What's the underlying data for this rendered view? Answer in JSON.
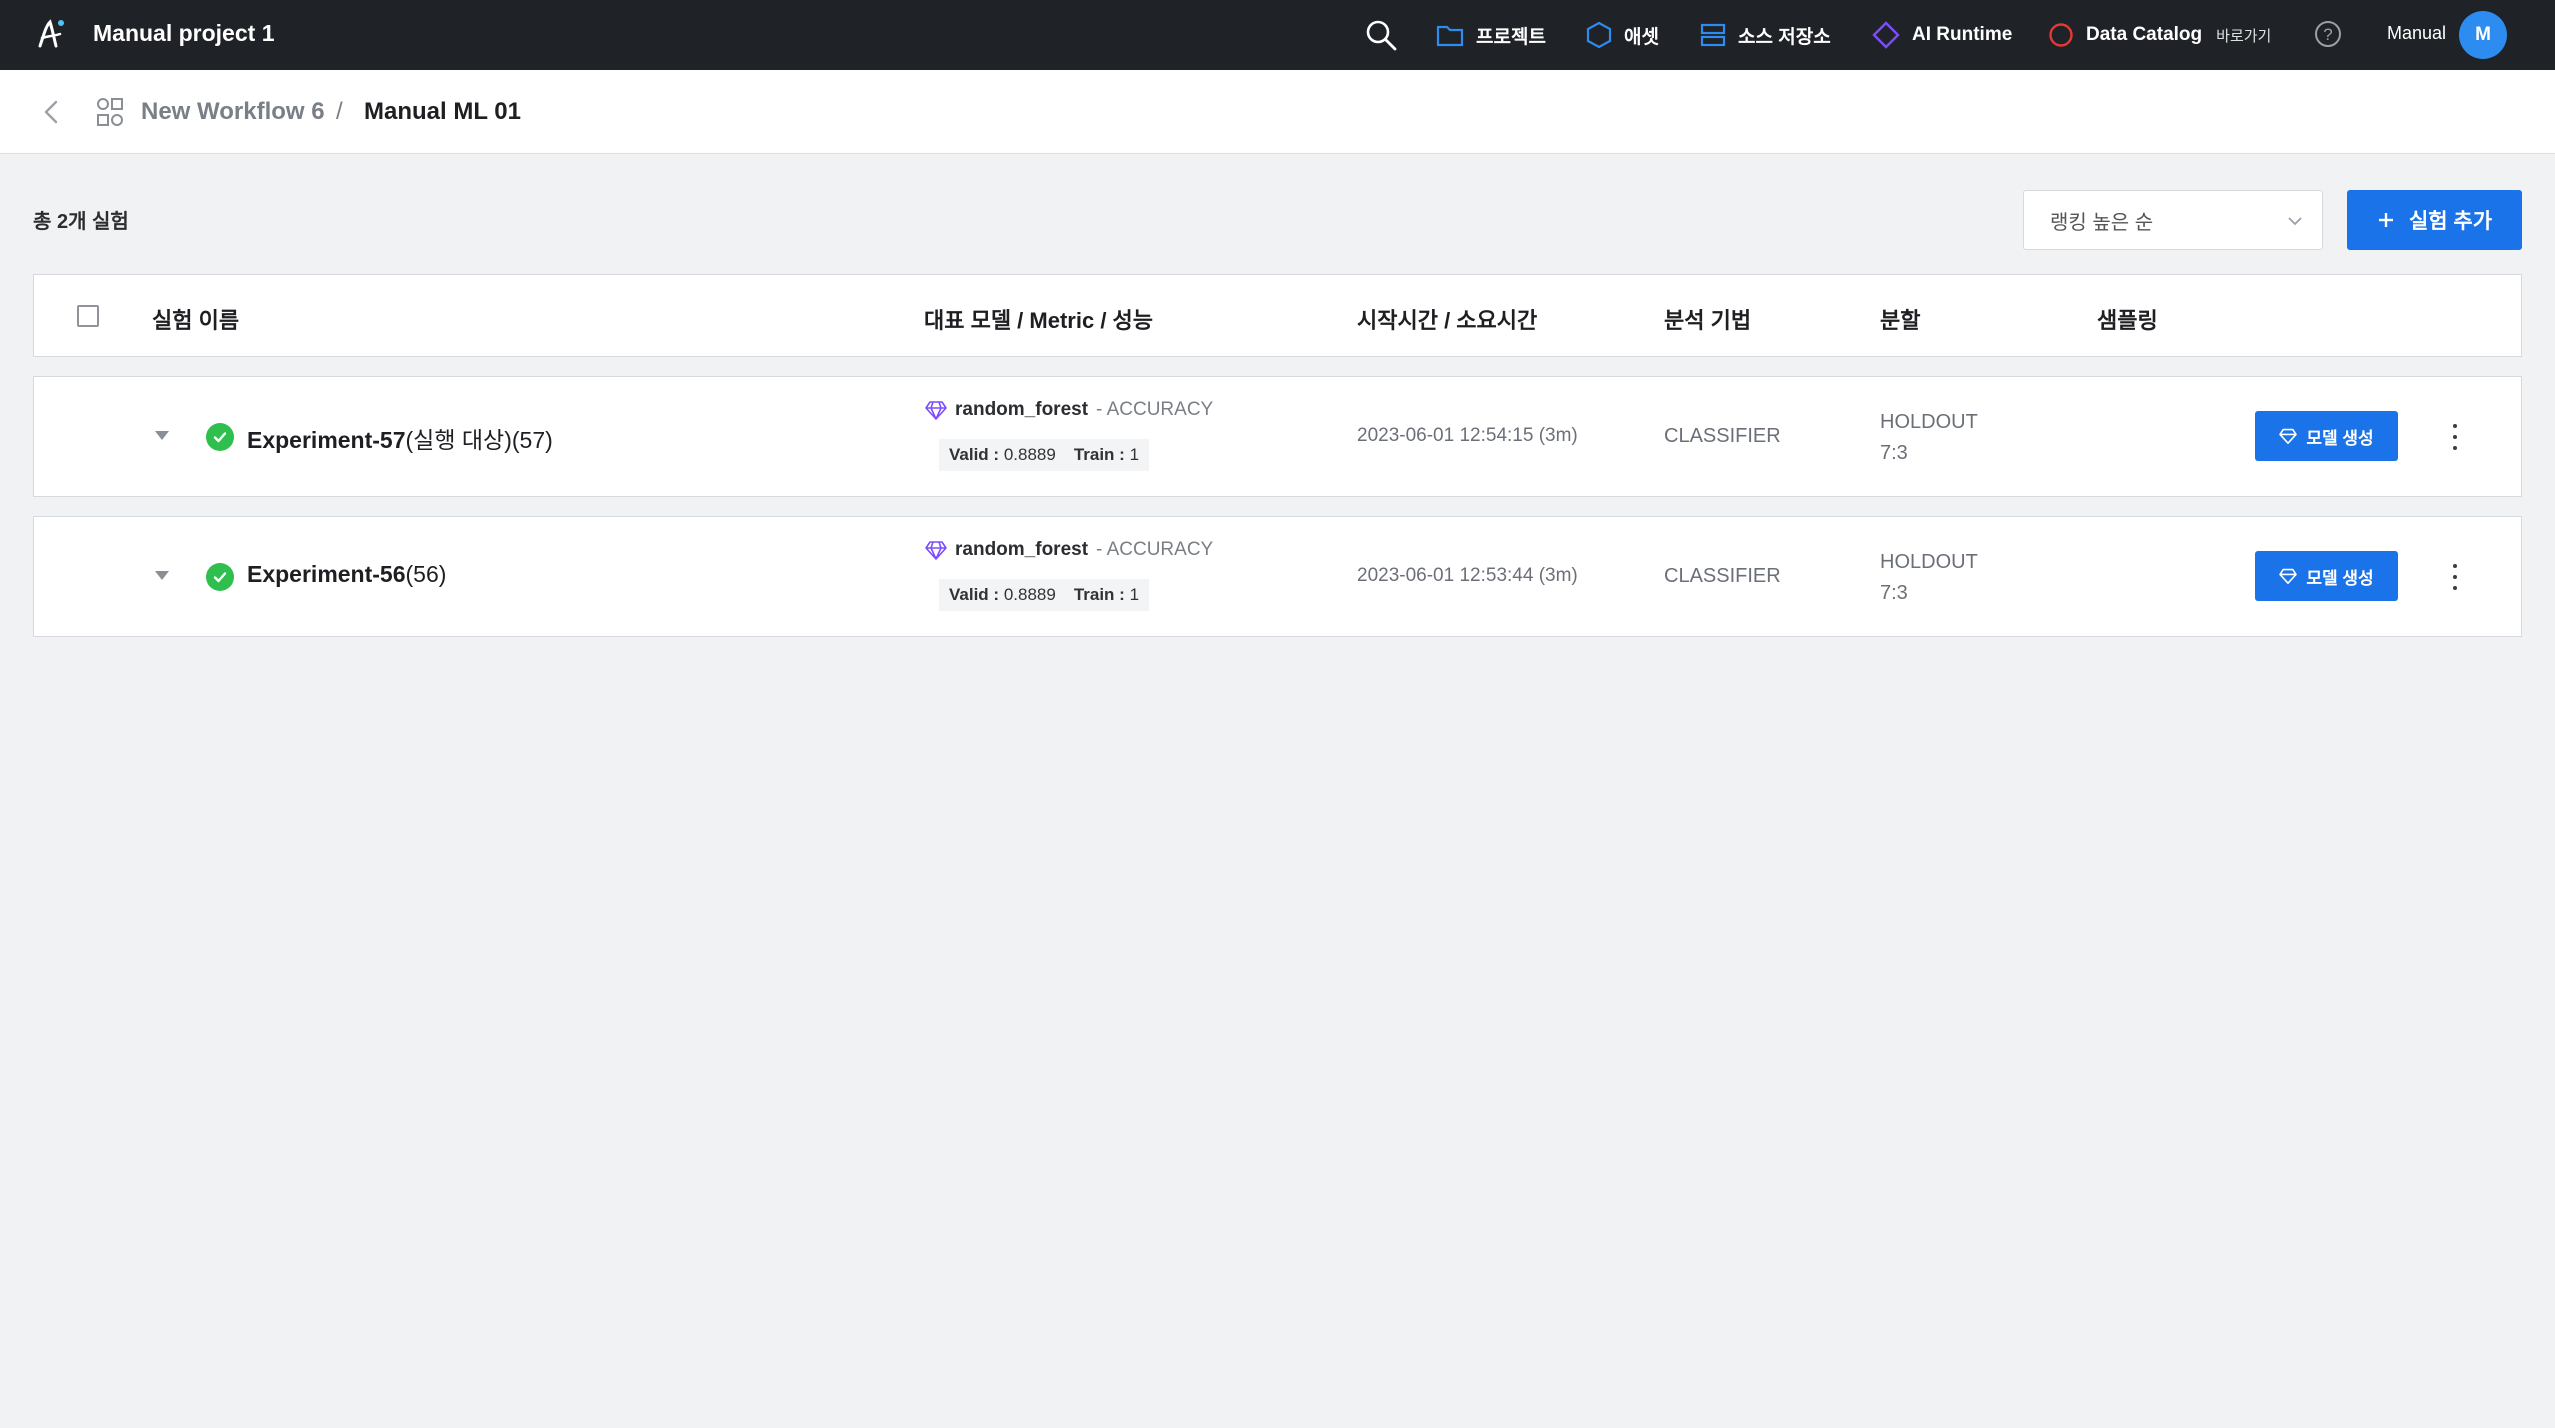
{
  "topbar": {
    "project_title": "Manual project 1",
    "nav": [
      {
        "label": "프로젝트",
        "icon": "folder-icon"
      },
      {
        "label": "애셋",
        "icon": "hexagon-icon"
      },
      {
        "label": "소스 저장소",
        "icon": "storage-icon"
      },
      {
        "label": "AI Runtime",
        "icon": "diamond-icon"
      },
      {
        "label": "Data Catalog",
        "sub": "바로가기",
        "icon": "circle-icon"
      }
    ],
    "user_name": "Manual",
    "avatar_initial": "M",
    "colors": {
      "bg": "#1f2227",
      "avatar": "#2d8cf0",
      "folder": "#2d8cf0",
      "asset": "#2d8cf0",
      "storage": "#2d8cf0",
      "runtime": "#7c4dff",
      "catalog": "#e53935"
    }
  },
  "breadcrumb": {
    "workflow": "New Workflow 6",
    "separator": "/",
    "current": "Manual ML 01"
  },
  "toolbar": {
    "total_label": "총 2개 실험",
    "sort_selected": "랭킹 높은 순",
    "add_label": "실험 추가",
    "accent": "#1a73e8"
  },
  "table": {
    "headers": {
      "name": "실험 이름",
      "model": "대표 모델 / Metric / 성능",
      "time": "시작시간 / 소요시간",
      "method": "분석 기법",
      "split": "분할",
      "sampling": "샘플링"
    },
    "rows": [
      {
        "name": "Experiment-57",
        "suffix": "(실행 대상)(57)",
        "model": "random_forest",
        "metric": "- ACCURACY",
        "valid_label": "Valid :",
        "valid": "0.8889",
        "train_label": "Train :",
        "train": "1",
        "time": "2023-06-01 12:54:15 (3m)",
        "method": "CLASSIFIER",
        "split_type": "HOLDOUT",
        "split_ratio": "7:3",
        "sampling": "",
        "model_btn": "모델 생성",
        "status": "success"
      },
      {
        "name": "Experiment-56",
        "suffix": "(56)",
        "model": "random_forest",
        "metric": "- ACCURACY",
        "valid_label": "Valid :",
        "valid": "0.8889",
        "train_label": "Train :",
        "train": "1",
        "time": "2023-06-01 12:53:44 (3m)",
        "method": "CLASSIFIER",
        "split_type": "HOLDOUT",
        "split_ratio": "7:3",
        "sampling": "",
        "model_btn": "모델 생성",
        "status": "success"
      }
    ]
  }
}
